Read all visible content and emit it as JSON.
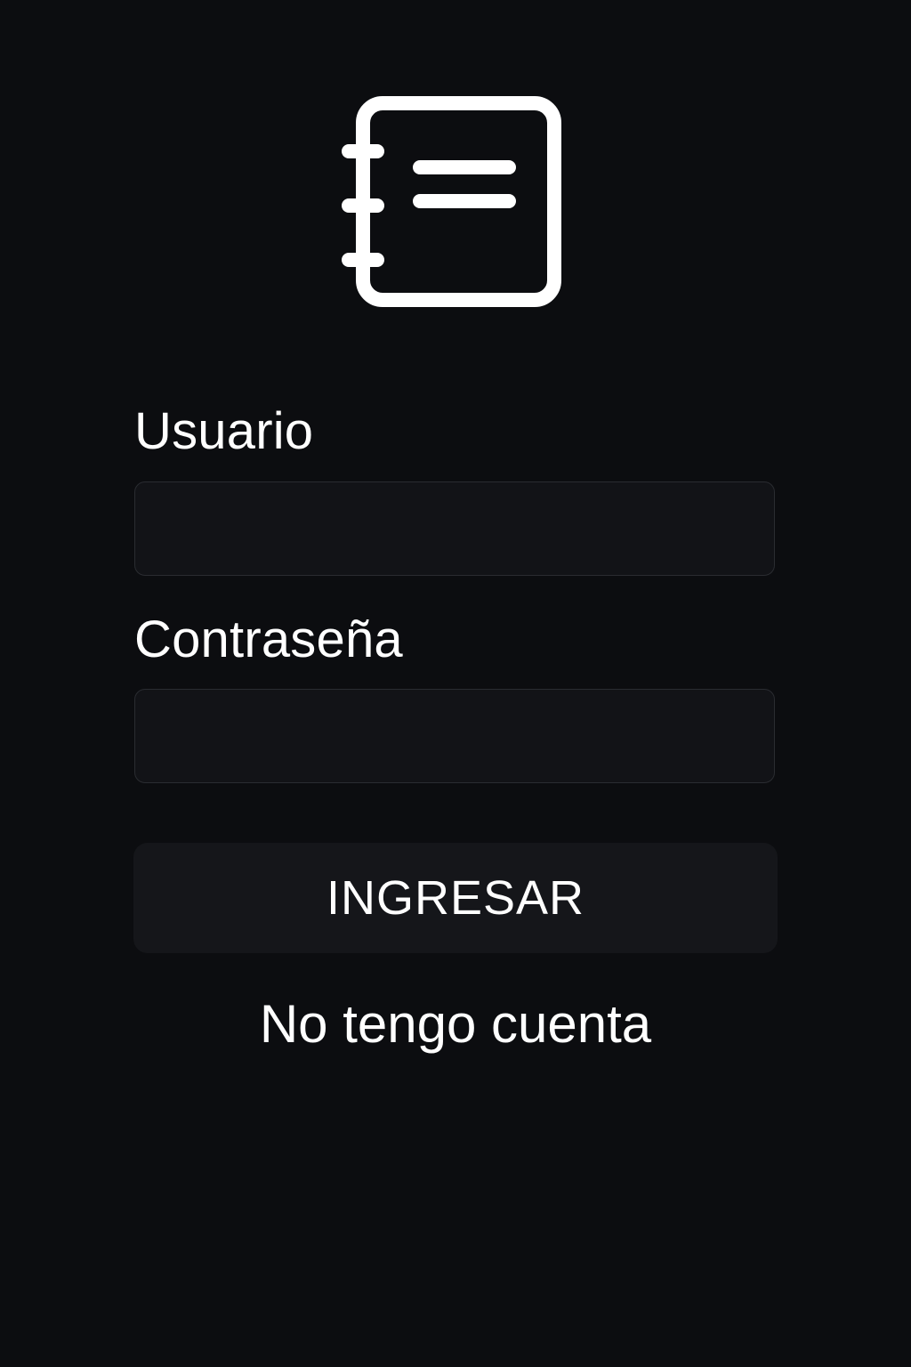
{
  "logo": {
    "icon": "notebook-icon",
    "color": "#ffffff"
  },
  "form": {
    "username": {
      "label": "Usuario",
      "value": "",
      "placeholder": ""
    },
    "password": {
      "label": "Contraseña",
      "value": "",
      "placeholder": ""
    },
    "submit_label": "INGRESAR",
    "register_link": "No tengo cuenta"
  },
  "colors": {
    "background": "#0c0d10",
    "field_background": "#121317",
    "field_border": "#2a2c31",
    "button_background": "#15161a",
    "text": "#ffffff"
  }
}
